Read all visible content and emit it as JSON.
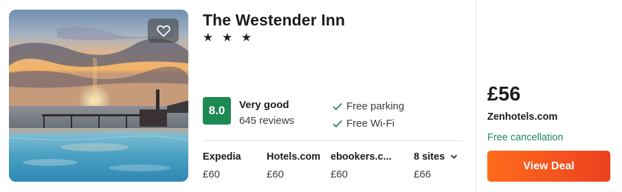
{
  "hotel": {
    "name": "The Westender Inn",
    "stars": "★ ★ ★"
  },
  "rating": {
    "score": "8.0",
    "label": "Very good",
    "reviews": "645 reviews",
    "badge_color": "#1e8a53"
  },
  "amenities": [
    {
      "label": "Free parking",
      "icon": "check-icon"
    },
    {
      "label": "Free Wi-Fi",
      "icon": "check-icon"
    }
  ],
  "sites": [
    {
      "name": "Expedia",
      "price": "£60"
    },
    {
      "name": "Hotels.com",
      "price": "£60"
    },
    {
      "name": "ebookers.c...",
      "price": "£60"
    },
    {
      "name": "8 sites",
      "price": "£66"
    }
  ],
  "deal": {
    "price": "£56",
    "provider": "Zenhotels.com",
    "cancellation": "Free cancellation",
    "button_label": "View Deal",
    "button_color": "#f4521e"
  },
  "icons": {
    "favorite": "heart-icon",
    "more_sites": "chevron-down-icon"
  }
}
